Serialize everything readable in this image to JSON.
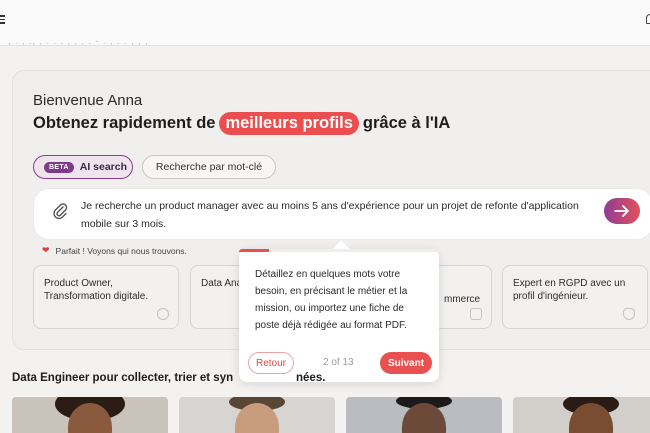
{
  "topbar": {
    "menu_icon": "hamburger-icon",
    "breadcrumb_fragment": ", . , ., , . . . , , , . - . , . . , , ,",
    "right_icon": "bell-icon"
  },
  "hero": {
    "welcome": "Bienvenue Anna",
    "headline_before": "Obtenez rapidement de",
    "headline_highlight": "meilleurs profils",
    "headline_after": "grâce à l'IA"
  },
  "search_modes": {
    "beta_badge": "BETA",
    "ai_label": "AI search",
    "keyword_label": "Recherche par mot-clé"
  },
  "prompt": {
    "text": "Je recherche un product manager avec au moins 5 ans d'expérience pour un projet de refonte d'application mobile sur 3 mois.",
    "attach_icon": "paperclip-icon",
    "send_icon": "arrow-right-icon"
  },
  "status": {
    "icon": "heart-icon",
    "text": "Parfait ! Voyons qui nous trouvons."
  },
  "suggestions": [
    {
      "text": "Product Owner, Transformation digitale.",
      "icon": "heart-outline-icon"
    },
    {
      "text": "Data Ana possible",
      "icon": ""
    },
    {
      "text": "mmerce",
      "icon": "document-icon"
    },
    {
      "text": "Expert en RGPD avec un profil d'ingénieur.",
      "icon": "shield-icon"
    }
  ],
  "tooltip": {
    "text": "Détaillez en quelques mots votre besoin, en précisant le métier et la mission, ou importez une fiche de poste déjà rédigée au format PDF.",
    "back_label": "Retour",
    "step_counter": "2 of 13",
    "next_label": "Suivant",
    "progress": 0.15
  },
  "section": {
    "title_part1": "Data Engineer pour collecter, trier et syn",
    "title_part2": "nées."
  },
  "colors": {
    "accent": "#ea4e4e",
    "ai_purple": "#7e3b88"
  }
}
